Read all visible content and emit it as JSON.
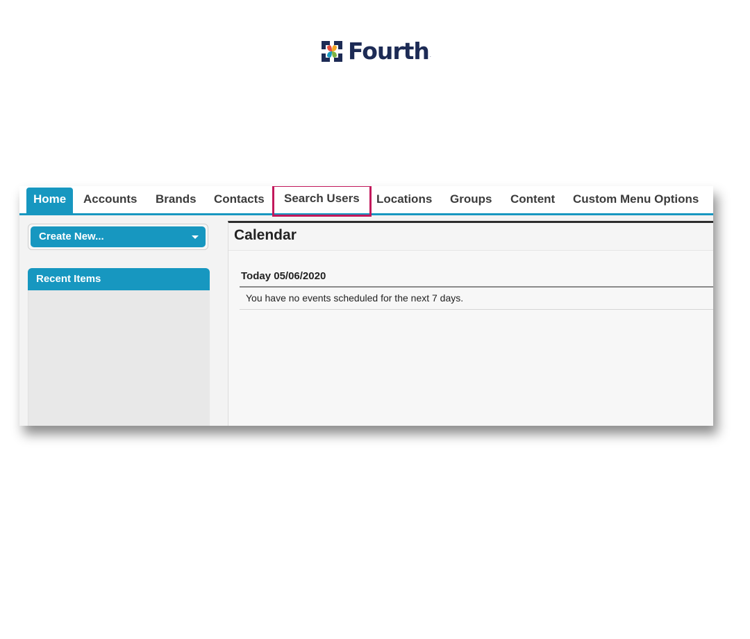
{
  "brand": {
    "name": "Fourth",
    "trademark": ".",
    "logo_colors": [
      "#1d2b55",
      "#e84c3d",
      "#f4a623",
      "#1797c0",
      "#7cb342"
    ]
  },
  "tabs": [
    {
      "label": "Home",
      "active": true
    },
    {
      "label": "Accounts"
    },
    {
      "label": "Brands"
    },
    {
      "label": "Contacts"
    },
    {
      "label": "Search Users",
      "highlighted": true
    },
    {
      "label": "Locations"
    },
    {
      "label": "Groups"
    },
    {
      "label": "Content"
    },
    {
      "label": "Custom Menu Options"
    }
  ],
  "sidebar": {
    "create_new_label": "Create New...",
    "recent_items_label": "Recent Items"
  },
  "calendar": {
    "title": "Calendar",
    "today_label": "Today 05/06/2020",
    "no_events_text": "You have no events scheduled for the next 7 days."
  },
  "colors": {
    "accent": "#1797c0",
    "highlight_border": "#c2185b"
  }
}
